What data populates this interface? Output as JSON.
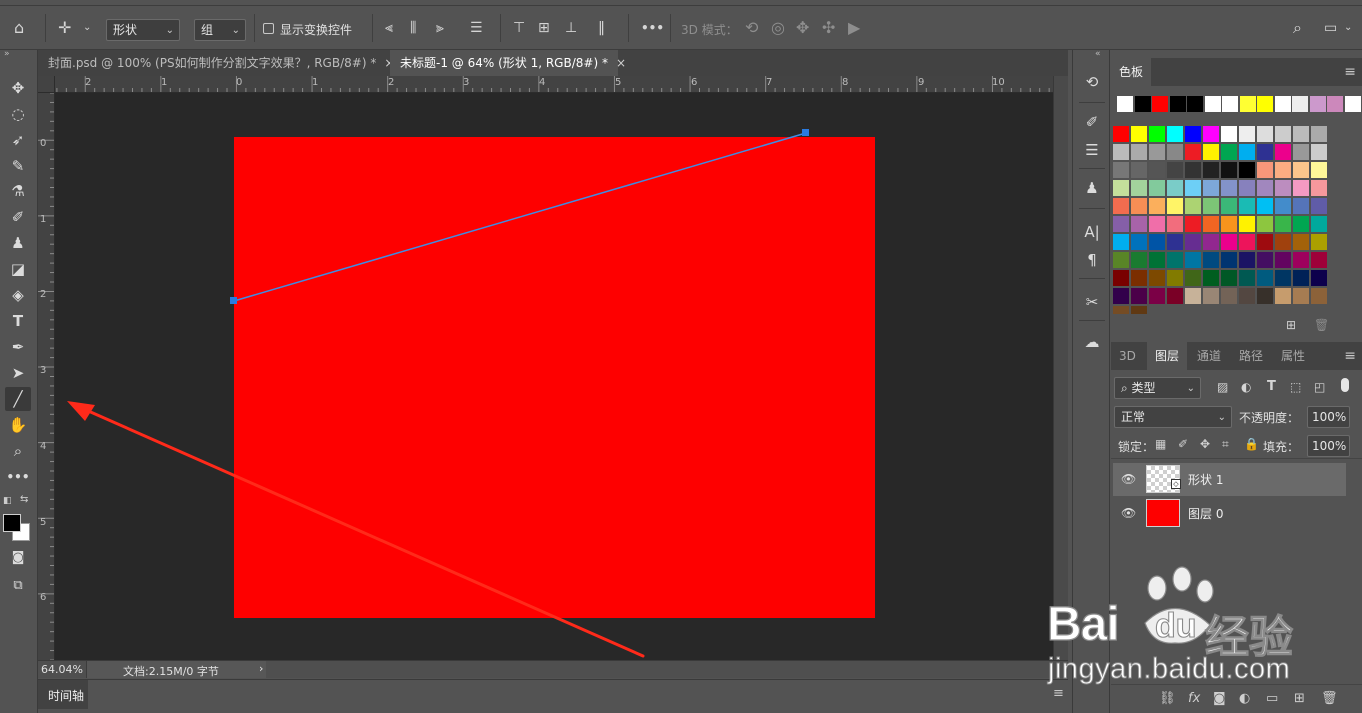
{
  "options_bar": {
    "shape_mode": "形状",
    "group_mode": "组",
    "show_transform_label": "显示变换控件",
    "more_label": "•••",
    "mode_3d_label": "3D 模式："
  },
  "tabs": [
    {
      "label": "封面.psd @ 100% (PS如何制作分割文字效果？, RGB/8#) *",
      "close": "×"
    },
    {
      "label": "未标题-1 @ 64% (形状 1, RGB/8#) *",
      "close": "×"
    }
  ],
  "ruler_top": [
    "2",
    "1",
    "0",
    "1",
    "2",
    "3",
    "4",
    "5",
    "6",
    "7",
    "8",
    "9",
    "10"
  ],
  "ruler_left": [
    "0",
    "1",
    "2",
    "3",
    "4",
    "5",
    "6"
  ],
  "status": {
    "zoom": "64.04%",
    "doc_info": "文档:2.15M/0 字节",
    "arrow": "›"
  },
  "timeline_label": "时间轴",
  "swatches": {
    "tab_label": "色板",
    "row0": [
      "#ffffff",
      "#000000",
      "#ff0000",
      "#000000",
      "#000000",
      "#ffffff",
      "#ffffff",
      "#ffff33",
      "#ffff00",
      "#ffffff",
      "#eeeeee",
      "#cc99cc",
      "#cc88bb",
      "#ffffff"
    ],
    "grid": [
      [
        "#ff0000",
        "#ffff00",
        "#00ff00",
        "#00ffff",
        "#0000ff",
        "#ff00ff",
        "#ffffff",
        "#eeeeee",
        "#dddddd",
        "#cccccc",
        "#bbbbbb",
        "#aaaaaa"
      ],
      [
        "#bbbbbb",
        "#aaaaaa",
        "#999999",
        "#888888",
        "#ed1c24",
        "#fff200",
        "#00a651",
        "#00aeef",
        "#2e3192",
        "#ec008c",
        "#999999",
        "#cccccc"
      ],
      [
        "#777777",
        "#666666",
        "#555555",
        "#444444",
        "#333333",
        "#222222",
        "#111111",
        "#000000",
        "#f7977a",
        "#fbad82",
        "#fdc68c",
        "#fff799"
      ],
      [
        "#c4df9b",
        "#a3d39c",
        "#82ca9c",
        "#7accc8",
        "#6dcff6",
        "#7da7d9",
        "#8393ca",
        "#8781bd",
        "#a187be",
        "#bc8dbf",
        "#f49ac2",
        "#f6989d"
      ],
      [
        "#f26c4f",
        "#f68e55",
        "#fbaf5c",
        "#fff467",
        "#acd372",
        "#7cc576",
        "#3bb878",
        "#1abbb4",
        "#00bff3",
        "#438ccb",
        "#5574b9",
        "#605ca8"
      ],
      [
        "#855fa8",
        "#a763a9",
        "#f06ea9",
        "#f26d7d",
        "#ed1c24",
        "#f26522",
        "#f7941d",
        "#fff200",
        "#8dc63f",
        "#39b54a",
        "#00a651",
        "#00a99d"
      ],
      [
        "#00aeef",
        "#0072bc",
        "#0054a6",
        "#2e3192",
        "#662d91",
        "#92278f",
        "#ec008c",
        "#ed145b",
        "#9e0b0f",
        "#a0410d",
        "#a3620a",
        "#aba000"
      ],
      [
        "#598527",
        "#1a7b30",
        "#007236",
        "#00746b",
        "#0076a3",
        "#004a80",
        "#003471",
        "#1b1464",
        "#440e62",
        "#630460",
        "#9e005d",
        "#9e0039"
      ],
      [
        "#790000",
        "#7b2e00",
        "#7d4900",
        "#827b00",
        "#406618",
        "#005e20",
        "#005826",
        "#005952",
        "#005b7f",
        "#003663",
        "#002157",
        "#0d004c"
      ],
      [
        "#32004b",
        "#4b0049",
        "#7b0046",
        "#7a0026",
        "#c7b299",
        "#998675",
        "#736357",
        "#534741",
        "#37302a",
        "#c69c6d",
        "#a67c52",
        "#8c6239"
      ],
      [
        "#754c24",
        "#603913"
      ]
    ]
  },
  "layers_panel": {
    "tabs": [
      "3D",
      "图层",
      "通道",
      "路径",
      "属性"
    ],
    "active_tab": "图层",
    "filter_label": "类型",
    "blend_mode": "正常",
    "opacity_label": "不透明度：",
    "opacity_value": "100%",
    "lock_label": "锁定：",
    "fill_label": "填充：",
    "fill_value": "100%",
    "layers": [
      {
        "name": "形状 1",
        "selected": true
      },
      {
        "name": "图层 0",
        "selected": false
      }
    ]
  },
  "canvas": {
    "artboard_color": "#fe0000",
    "path_color": "#3e8de4",
    "arrow_color": "#ff2a1a"
  },
  "watermark": {
    "brand": "Bai",
    "brand2": "du",
    "cn": "经验",
    "url": "jingyan.baidu.com"
  }
}
